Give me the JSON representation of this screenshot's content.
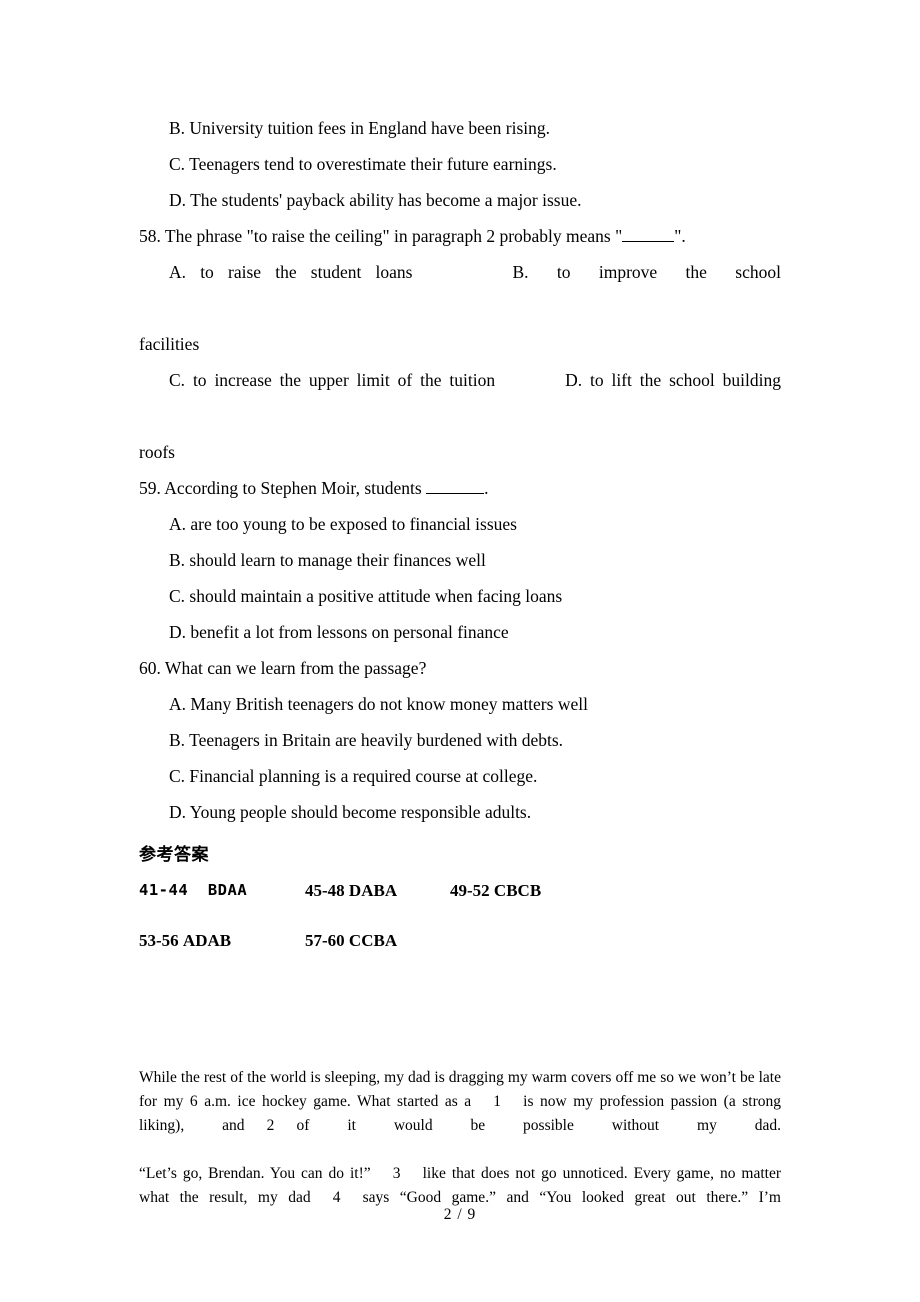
{
  "document": {
    "page_footer": "2 / 9"
  },
  "questions": [
    {
      "id": "q57-options",
      "lines": [
        {
          "kind": "option",
          "text": "B. University tuition fees in England have been rising."
        },
        {
          "kind": "option",
          "text": "C. Teenagers tend to overestimate their future earnings."
        },
        {
          "kind": "option",
          "text": "D. The students' payback ability has become a major issue."
        }
      ]
    }
  ],
  "q58": {
    "stem_before": "58. The phrase \"to raise the ceiling\" in paragraph 2 probably means \"",
    "stem_after": "\".",
    "optionA": "A. to raise the student loans",
    "optionB": "B.  to  improve  the  school",
    "optionB_wrap": "facilities",
    "optionC": "C. to increase the upper limit of the tuition",
    "optionD": "D. to lift the school building",
    "optionD_wrap": "roofs"
  },
  "q59": {
    "stem_before": "59. According to Stephen Moir, students ",
    "stem_after": ".",
    "options": [
      "A. are too young to be exposed to financial issues",
      "B. should learn to manage their finances well",
      "C. should maintain a positive attitude when facing loans",
      "D. benefit a lot from lessons on personal finance"
    ]
  },
  "q60": {
    "stem": "60. What can we learn from the passage?",
    "options": [
      "A. Many British teenagers do not know money matters well",
      "B. Teenagers in Britain are heavily burdened with debts.",
      "C. Financial planning is a required course at college.",
      "D. Young people should become responsible adults."
    ]
  },
  "answer_key": {
    "title": "参考答案",
    "row1": [
      {
        "range": "41-44",
        "answers": "BDAA"
      },
      {
        "range": "45-48",
        "answers": "DABA"
      },
      {
        "range": "49-52",
        "answers": "CBCB"
      }
    ],
    "row2": [
      {
        "range": "53-56",
        "answers": "ADAB"
      },
      {
        "range": "57-60",
        "answers": "CCBA"
      }
    ]
  },
  "cloze_passage": {
    "para1_a": "While the rest of the world is sleeping, my dad is dragging my warm covers off me so we won’t be late for my 6 a.m. ice hockey game. What started as a",
    "blank1": "1",
    "para1_b": "is now my profession passion (a strong liking), and",
    "blank2": "2",
    "para1_c": "of it would be possible without my dad.",
    "para2_a": "“Let’s go, Brendan. You can do it!”",
    "blank3": "3",
    "para2_b": "like that does not go unnoticed. Every game, no matter what the result, my dad",
    "blank4": "4",
    "para2_c": "says “Good game.” and “You looked great out there.” I’m"
  }
}
